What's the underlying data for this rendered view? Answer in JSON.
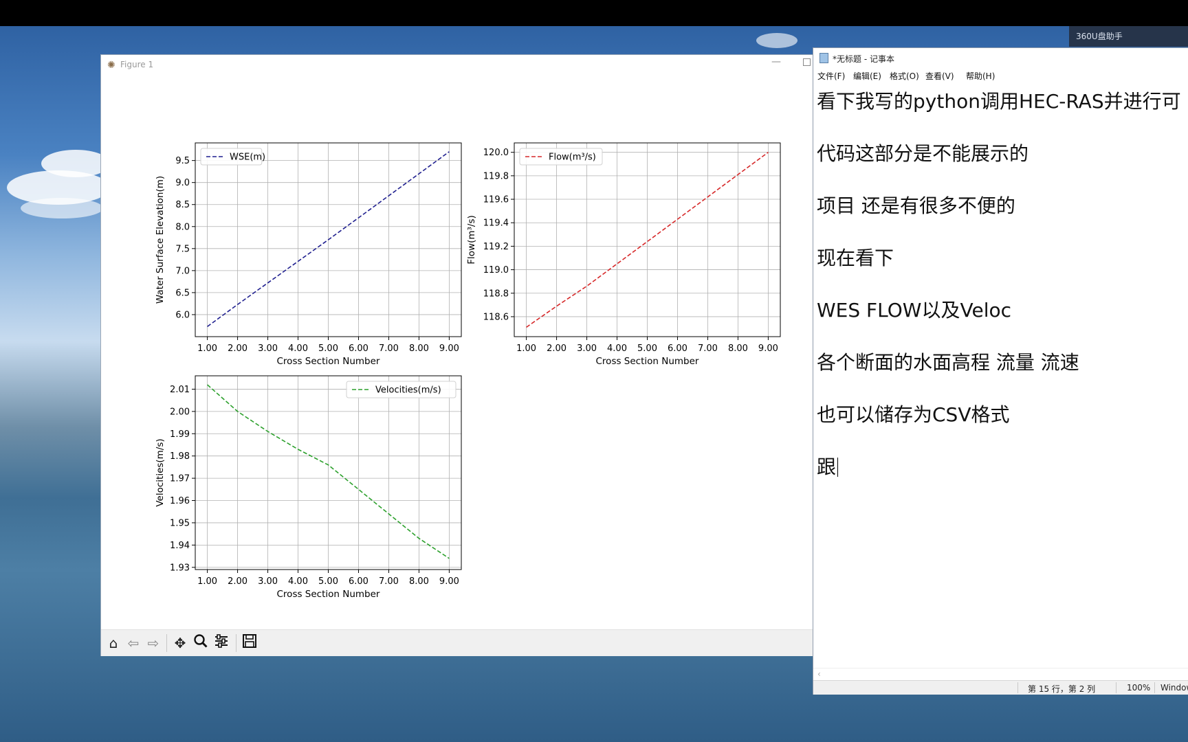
{
  "tray": {
    "label": "360U盘助手"
  },
  "figure_window": {
    "title": "Figure 1",
    "toolbar_icons": [
      "home-icon",
      "back-icon",
      "forward-icon",
      "pan-icon",
      "zoom-icon",
      "configure-subplots-icon",
      "save-icon"
    ]
  },
  "chart_data": [
    {
      "type": "line",
      "x": [
        1,
        2,
        3,
        4,
        5,
        6,
        7,
        8,
        9
      ],
      "series": [
        {
          "name": "WSE(m)",
          "values": [
            5.73,
            6.23,
            6.72,
            7.21,
            7.7,
            8.2,
            8.7,
            9.2,
            9.7
          ],
          "color": "#1f1f8f",
          "style": "dashed"
        }
      ],
      "xlabel": "Cross Section Number",
      "ylabel": "Water Surface Elevation(m)",
      "xlim": [
        0.6,
        9.4
      ],
      "ylim": [
        5.5,
        9.9
      ],
      "xticks": [
        "1.00",
        "2.00",
        "3.00",
        "4.00",
        "5.00",
        "6.00",
        "7.00",
        "8.00",
        "9.00"
      ],
      "yticks": [
        "6.0",
        "6.5",
        "7.0",
        "7.5",
        "8.0",
        "8.5",
        "9.0",
        "9.5"
      ],
      "grid": true,
      "legend": "upper left"
    },
    {
      "type": "line",
      "x": [
        1,
        2,
        3,
        4,
        5,
        6,
        7,
        8,
        9
      ],
      "series": [
        {
          "name": "Flow(m³/s)",
          "values": [
            118.51,
            118.69,
            118.86,
            119.05,
            119.24,
            119.43,
            119.62,
            119.81,
            120.0
          ],
          "color": "#d62728",
          "style": "dashed"
        }
      ],
      "xlabel": "Cross Section Number",
      "ylabel": "Flow(m³/s)",
      "xlim": [
        0.6,
        9.4
      ],
      "ylim": [
        118.43,
        120.08
      ],
      "xticks": [
        "1.00",
        "2.00",
        "3.00",
        "4.00",
        "5.00",
        "6.00",
        "7.00",
        "8.00",
        "9.00"
      ],
      "yticks": [
        "118.6",
        "118.8",
        "119.0",
        "119.2",
        "119.4",
        "119.6",
        "119.8",
        "120.0"
      ],
      "grid": true,
      "legend": "upper left"
    },
    {
      "type": "line",
      "x": [
        1,
        2,
        3,
        4,
        5,
        6,
        7,
        8,
        9
      ],
      "series": [
        {
          "name": "Velocities(m/s)",
          "values": [
            2.012,
            2.0,
            1.991,
            1.983,
            1.976,
            1.965,
            1.954,
            1.943,
            1.934
          ],
          "color": "#2ca02c",
          "style": "dashed"
        }
      ],
      "xlabel": "Cross Section Number",
      "ylabel": "Velocities(m/s)",
      "xlim": [
        0.6,
        9.4
      ],
      "ylim": [
        1.929,
        2.016
      ],
      "xticks": [
        "1.00",
        "2.00",
        "3.00",
        "4.00",
        "5.00",
        "6.00",
        "7.00",
        "8.00",
        "9.00"
      ],
      "yticks": [
        "1.93",
        "1.94",
        "1.95",
        "1.96",
        "1.97",
        "1.98",
        "1.99",
        "2.00",
        "2.01"
      ],
      "grid": true,
      "legend": "upper right"
    }
  ],
  "notepad": {
    "title": "*无标题 - 记事本",
    "menu": [
      "文件(F)",
      "编辑(E)",
      "格式(O)",
      "查看(V)",
      "帮助(H)"
    ],
    "lines": [
      "看下我写的python调用HEC-RAS并进行可",
      "代码这部分是不能展示的",
      "项目 还是有很多不便的",
      "现在看下",
      "WES FLOW以及Veloc",
      "各个断面的水面高程 流量 流速",
      "也可以储存为CSV格式",
      "跟"
    ],
    "status": {
      "position": "第 15 行，第 2 列",
      "zoom": "100%",
      "eol": "Windows"
    }
  }
}
